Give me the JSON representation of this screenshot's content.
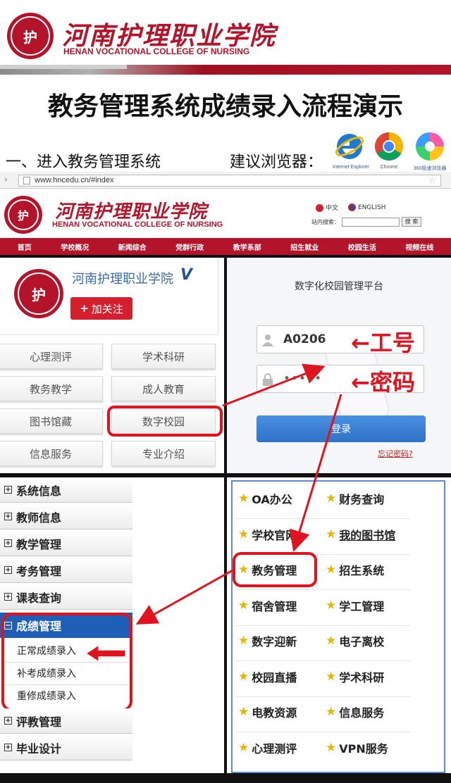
{
  "header": {
    "school_cn": "河南护理职业学院",
    "school_en": "HENAN VOCATIONAL COLLEGE OF NURSING"
  },
  "title": "教务管理系统成绩录入流程演示",
  "step1": "一、进入教务管理系统",
  "browser_tip": "建议浏览器：",
  "browsers": [
    {
      "icon": "ie-icon",
      "label": "Internet Explorer"
    },
    {
      "icon": "chrome-icon",
      "label": "Chrome"
    },
    {
      "icon": "360-browser-icon",
      "label": "360极速浏览器"
    }
  ],
  "address_bar": {
    "url": "www.hncedu.cn/#index"
  },
  "site": {
    "name_cn": "河南护理职业学院",
    "name_en": "HENAN VOCATIONAL COLLEGE OF NURSING",
    "lang_cn": "中文",
    "lang_en": "ENGLISH",
    "search_label": "站内搜索：",
    "search_button": "搜 索",
    "nav": [
      "首页",
      "学校概况",
      "新闻综合",
      "党群行政",
      "教学系部",
      "招生就业",
      "校园生活",
      "视频在线"
    ]
  },
  "profile": {
    "name": "河南护理职业学院",
    "verified": "V",
    "follow_button": "加关注",
    "menu": [
      "心理测评",
      "学术科研",
      "教务教学",
      "成人教育",
      "图书馆藏",
      "数字校园",
      "信息服务",
      "专业介绍"
    ]
  },
  "login": {
    "title": "数字化校园管理平台",
    "username_value": "A0206",
    "password_value": "•••••",
    "login_button": "登录",
    "forgot": "忘记密码?",
    "annot_username": "←工号",
    "annot_password": "←密码"
  },
  "left_menu": {
    "items_top": [
      "系统信息",
      "教师信息",
      "教学管理",
      "考务管理",
      "课表查询"
    ],
    "active": "成绩管理",
    "sub_items": [
      "正常成绩录入",
      "补考成绩录入",
      "重修成绩录入"
    ],
    "items_bottom": [
      "评教管理",
      "毕业设计"
    ]
  },
  "portal_grid": [
    [
      "OA办公",
      "财务查询"
    ],
    [
      "学校官网",
      "我的图书馆"
    ],
    [
      "教务管理",
      "招生系统"
    ],
    [
      "宿舍管理",
      "学工管理"
    ],
    [
      "数字迎新",
      "电子离校"
    ],
    [
      "校园直播",
      "学术科研"
    ],
    [
      "电教资源",
      "信息服务"
    ],
    [
      "心理测评",
      "VPN服务"
    ]
  ],
  "colors": {
    "brand": "#b3142a",
    "annotation": "#e0141e",
    "menu_active": "#1f5fb8",
    "link": "#3a6aa8"
  }
}
